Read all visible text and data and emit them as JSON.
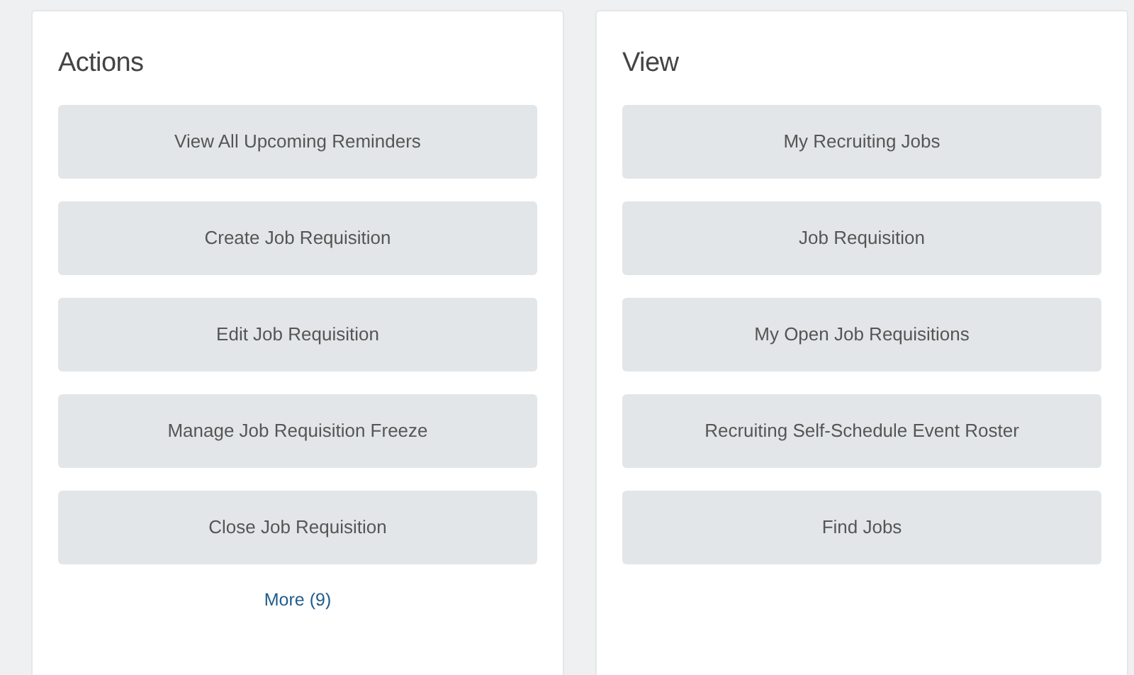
{
  "panels": [
    {
      "title": "Actions",
      "buttons": [
        "View All Upcoming Reminders",
        "Create Job Requisition",
        "Edit Job Requisition",
        "Manage Job Requisition Freeze",
        "Close Job Requisition"
      ],
      "more_link": "More (9)"
    },
    {
      "title": "View",
      "buttons": [
        "My Recruiting Jobs",
        "Job Requisition",
        "My Open Job Requisitions",
        "Recruiting Self-Schedule Event Roster",
        "Find Jobs"
      ]
    }
  ]
}
